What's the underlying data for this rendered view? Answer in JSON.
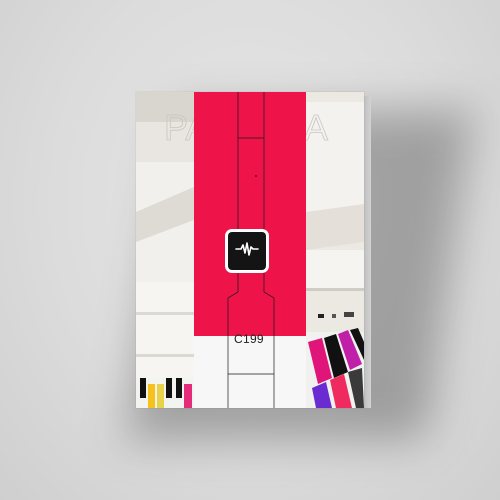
{
  "product": {
    "code": "C199",
    "logo_icon": "waveform-icon",
    "band_color": "#ee1348",
    "logo_bg_color": "#141414"
  },
  "background": {
    "color": "#dcdcdc"
  }
}
